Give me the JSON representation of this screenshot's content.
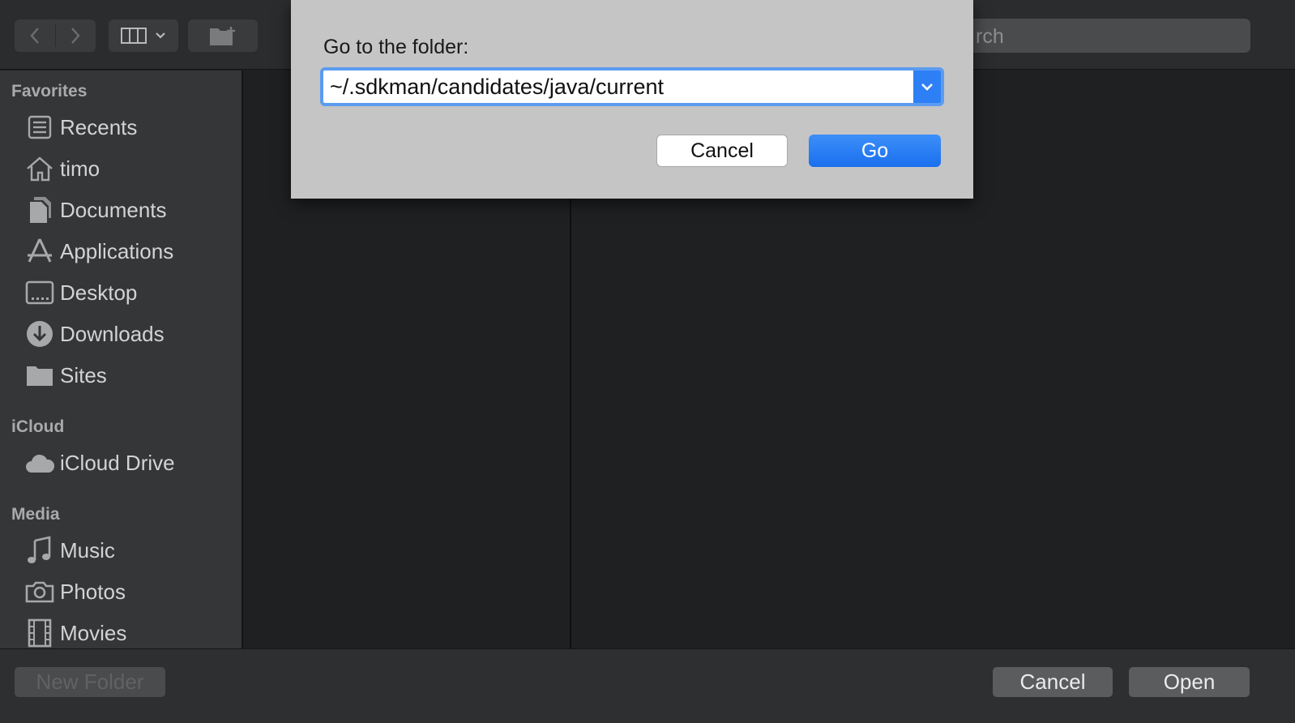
{
  "toolbar": {
    "back_icon": "chevron-left-icon",
    "forward_icon": "chevron-right-icon",
    "view_icon": "columns-view-icon",
    "new_folder_icon": "folder-plus-icon",
    "search_placeholder": "rch"
  },
  "sidebar": {
    "favorites_title": "Favorites",
    "favorites": [
      {
        "label": "Recents",
        "icon": "recents-icon"
      },
      {
        "label": "timo",
        "icon": "home-icon"
      },
      {
        "label": "Documents",
        "icon": "documents-icon"
      },
      {
        "label": "Applications",
        "icon": "applications-icon"
      },
      {
        "label": "Desktop",
        "icon": "desktop-icon"
      },
      {
        "label": "Downloads",
        "icon": "downloads-icon"
      },
      {
        "label": "Sites",
        "icon": "folder-icon"
      }
    ],
    "icloud_title": "iCloud",
    "icloud": [
      {
        "label": "iCloud Drive",
        "icon": "cloud-icon"
      }
    ],
    "media_title": "Media",
    "media": [
      {
        "label": "Music",
        "icon": "music-icon"
      },
      {
        "label": "Photos",
        "icon": "camera-icon"
      },
      {
        "label": "Movies",
        "icon": "film-icon"
      }
    ]
  },
  "bottombar": {
    "new_folder_label": "New Folder",
    "cancel_label": "Cancel",
    "open_label": "Open"
  },
  "sheet": {
    "title": "Go to the folder:",
    "path_value": "~/.sdkman/candidates/java/current",
    "cancel_label": "Cancel",
    "go_label": "Go"
  },
  "colors": {
    "accent": "#2d7ff6",
    "sidebar_bg": "#353638",
    "main_bg": "#1f2022",
    "sheet_bg": "#c5c5c6"
  }
}
